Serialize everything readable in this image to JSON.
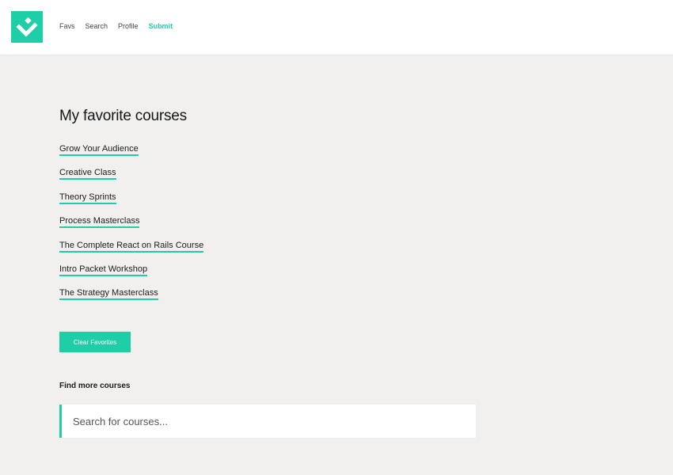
{
  "nav": {
    "items": [
      {
        "label": "Favs",
        "active": false
      },
      {
        "label": "Search",
        "active": false
      },
      {
        "label": "Profile",
        "active": false
      },
      {
        "label": "Submit",
        "active": true
      }
    ]
  },
  "logo": {
    "icon": "checkmark-logo-icon",
    "color": "#1ecea6"
  },
  "main": {
    "title": "My favorite courses",
    "courses": [
      "Grow Your Audience",
      "Creative Class",
      "Theory Sprints",
      "Process Masterclass",
      "The Complete React on Rails Course",
      "Intro Packet Workshop",
      "The Strategy Masterclass"
    ],
    "clear_button": "Clear Favorites",
    "find_label": "Find more courses",
    "search": {
      "placeholder": "Search for courses...",
      "value": ""
    }
  },
  "colors": {
    "accent": "#1ecea6",
    "background": "#f1f0ef"
  }
}
